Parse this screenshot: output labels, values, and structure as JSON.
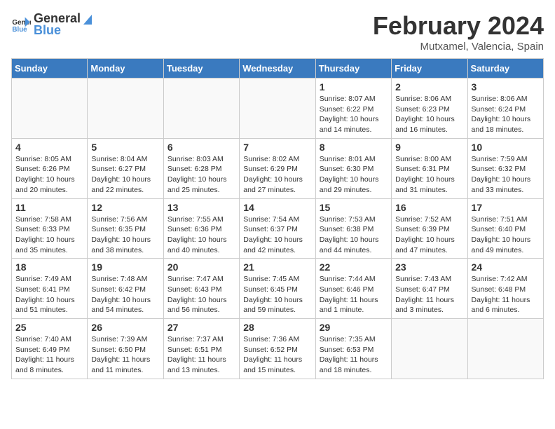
{
  "header": {
    "logo_general": "General",
    "logo_blue": "Blue",
    "title": "February 2024",
    "subtitle": "Mutxamel, Valencia, Spain"
  },
  "days_of_week": [
    "Sunday",
    "Monday",
    "Tuesday",
    "Wednesday",
    "Thursday",
    "Friday",
    "Saturday"
  ],
  "weeks": [
    [
      {
        "day": "",
        "info": ""
      },
      {
        "day": "",
        "info": ""
      },
      {
        "day": "",
        "info": ""
      },
      {
        "day": "",
        "info": ""
      },
      {
        "day": "1",
        "info": "Sunrise: 8:07 AM\nSunset: 6:22 PM\nDaylight: 10 hours\nand 14 minutes."
      },
      {
        "day": "2",
        "info": "Sunrise: 8:06 AM\nSunset: 6:23 PM\nDaylight: 10 hours\nand 16 minutes."
      },
      {
        "day": "3",
        "info": "Sunrise: 8:06 AM\nSunset: 6:24 PM\nDaylight: 10 hours\nand 18 minutes."
      }
    ],
    [
      {
        "day": "4",
        "info": "Sunrise: 8:05 AM\nSunset: 6:26 PM\nDaylight: 10 hours\nand 20 minutes."
      },
      {
        "day": "5",
        "info": "Sunrise: 8:04 AM\nSunset: 6:27 PM\nDaylight: 10 hours\nand 22 minutes."
      },
      {
        "day": "6",
        "info": "Sunrise: 8:03 AM\nSunset: 6:28 PM\nDaylight: 10 hours\nand 25 minutes."
      },
      {
        "day": "7",
        "info": "Sunrise: 8:02 AM\nSunset: 6:29 PM\nDaylight: 10 hours\nand 27 minutes."
      },
      {
        "day": "8",
        "info": "Sunrise: 8:01 AM\nSunset: 6:30 PM\nDaylight: 10 hours\nand 29 minutes."
      },
      {
        "day": "9",
        "info": "Sunrise: 8:00 AM\nSunset: 6:31 PM\nDaylight: 10 hours\nand 31 minutes."
      },
      {
        "day": "10",
        "info": "Sunrise: 7:59 AM\nSunset: 6:32 PM\nDaylight: 10 hours\nand 33 minutes."
      }
    ],
    [
      {
        "day": "11",
        "info": "Sunrise: 7:58 AM\nSunset: 6:33 PM\nDaylight: 10 hours\nand 35 minutes."
      },
      {
        "day": "12",
        "info": "Sunrise: 7:56 AM\nSunset: 6:35 PM\nDaylight: 10 hours\nand 38 minutes."
      },
      {
        "day": "13",
        "info": "Sunrise: 7:55 AM\nSunset: 6:36 PM\nDaylight: 10 hours\nand 40 minutes."
      },
      {
        "day": "14",
        "info": "Sunrise: 7:54 AM\nSunset: 6:37 PM\nDaylight: 10 hours\nand 42 minutes."
      },
      {
        "day": "15",
        "info": "Sunrise: 7:53 AM\nSunset: 6:38 PM\nDaylight: 10 hours\nand 44 minutes."
      },
      {
        "day": "16",
        "info": "Sunrise: 7:52 AM\nSunset: 6:39 PM\nDaylight: 10 hours\nand 47 minutes."
      },
      {
        "day": "17",
        "info": "Sunrise: 7:51 AM\nSunset: 6:40 PM\nDaylight: 10 hours\nand 49 minutes."
      }
    ],
    [
      {
        "day": "18",
        "info": "Sunrise: 7:49 AM\nSunset: 6:41 PM\nDaylight: 10 hours\nand 51 minutes."
      },
      {
        "day": "19",
        "info": "Sunrise: 7:48 AM\nSunset: 6:42 PM\nDaylight: 10 hours\nand 54 minutes."
      },
      {
        "day": "20",
        "info": "Sunrise: 7:47 AM\nSunset: 6:43 PM\nDaylight: 10 hours\nand 56 minutes."
      },
      {
        "day": "21",
        "info": "Sunrise: 7:45 AM\nSunset: 6:45 PM\nDaylight: 10 hours\nand 59 minutes."
      },
      {
        "day": "22",
        "info": "Sunrise: 7:44 AM\nSunset: 6:46 PM\nDaylight: 11 hours\nand 1 minute."
      },
      {
        "day": "23",
        "info": "Sunrise: 7:43 AM\nSunset: 6:47 PM\nDaylight: 11 hours\nand 3 minutes."
      },
      {
        "day": "24",
        "info": "Sunrise: 7:42 AM\nSunset: 6:48 PM\nDaylight: 11 hours\nand 6 minutes."
      }
    ],
    [
      {
        "day": "25",
        "info": "Sunrise: 7:40 AM\nSunset: 6:49 PM\nDaylight: 11 hours\nand 8 minutes."
      },
      {
        "day": "26",
        "info": "Sunrise: 7:39 AM\nSunset: 6:50 PM\nDaylight: 11 hours\nand 11 minutes."
      },
      {
        "day": "27",
        "info": "Sunrise: 7:37 AM\nSunset: 6:51 PM\nDaylight: 11 hours\nand 13 minutes."
      },
      {
        "day": "28",
        "info": "Sunrise: 7:36 AM\nSunset: 6:52 PM\nDaylight: 11 hours\nand 15 minutes."
      },
      {
        "day": "29",
        "info": "Sunrise: 7:35 AM\nSunset: 6:53 PM\nDaylight: 11 hours\nand 18 minutes."
      },
      {
        "day": "",
        "info": ""
      },
      {
        "day": "",
        "info": ""
      }
    ]
  ]
}
